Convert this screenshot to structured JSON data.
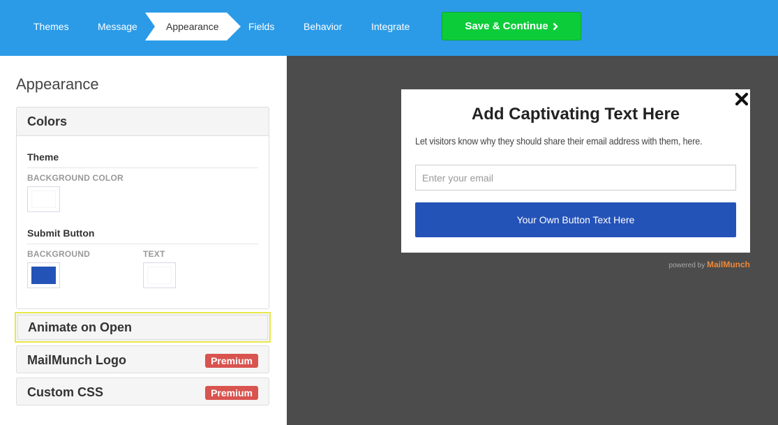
{
  "nav": {
    "steps": [
      {
        "label": "Themes"
      },
      {
        "label": "Message"
      },
      {
        "label": "Appearance"
      },
      {
        "label": "Fields"
      },
      {
        "label": "Behavior"
      },
      {
        "label": "Integrate"
      }
    ],
    "active_step": "Appearance",
    "save_label": "Save & Continue"
  },
  "sidebar": {
    "title": "Appearance",
    "colors": {
      "header": "Colors",
      "theme_title": "Theme",
      "background_color_label": "BACKGROUND COLOR",
      "submit_title": "Submit Button",
      "submit_background_label": "BACKGROUND",
      "submit_text_label": "TEXT",
      "theme_background_color": "#ffffff",
      "submit_background_color": "#2453b8",
      "submit_text_color": "#ffffff"
    },
    "sections": {
      "animate": "Animate on Open",
      "logo": "MailMunch Logo",
      "css": "Custom CSS"
    },
    "premium_label": "Premium"
  },
  "preview": {
    "headline": "Add Captivating Text Here",
    "subtext": "Let visitors know why they should share their email address with them, here.",
    "email_placeholder": "Enter your email",
    "button_label": "Your Own Button Text Here",
    "powered_by": "powered by",
    "brand": "MailMunch"
  },
  "colors": {
    "topbar": "#2b9be8",
    "save_button": "#0dcc3a",
    "preview_bg": "#4b4c4b",
    "premium_badge": "#d9534f",
    "highlight": "#e8e84a"
  }
}
